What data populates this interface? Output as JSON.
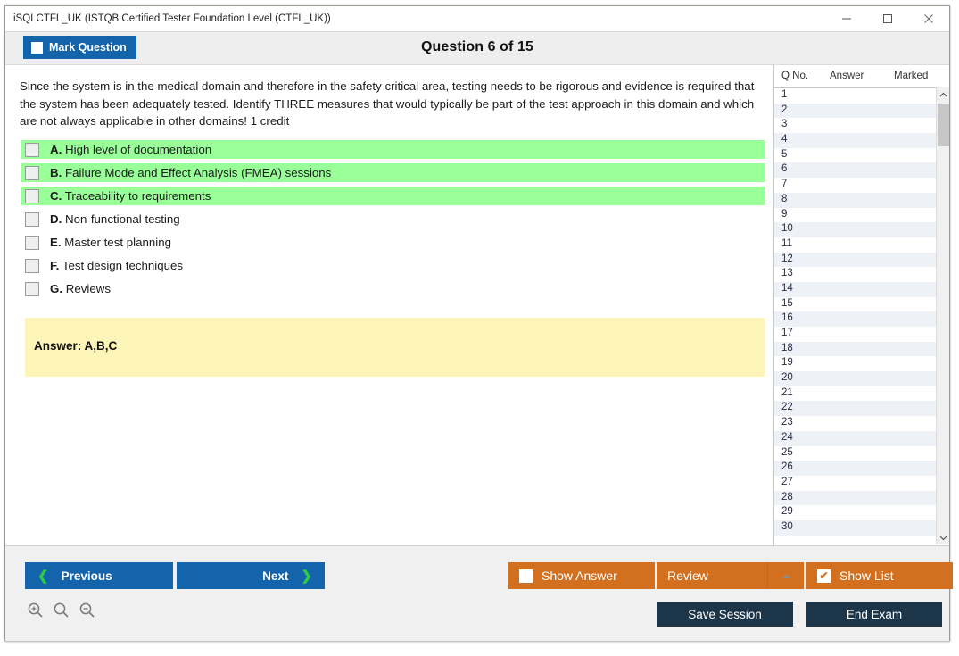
{
  "window": {
    "title": "iSQI CTFL_UK (ISTQB Certified Tester Foundation Level (CTFL_UK))",
    "minimize_label": "Minimize",
    "maximize_label": "Maximize",
    "close_label": "Close"
  },
  "header": {
    "mark_question_label": "Mark Question",
    "question_counter": "Question 6 of 15"
  },
  "question": {
    "text": "Since the system is in the medical domain and therefore in the safety critical area, testing needs to be rigorous and evidence is required that the system has been adequately tested. Identify THREE measures that would typically be part of the test approach in this domain and which are not always applicable in other domains! 1 credit",
    "options": [
      {
        "letter": "A.",
        "text": "High level of documentation",
        "correct": true
      },
      {
        "letter": "B.",
        "text": "Failure Mode and Effect Analysis (FMEA) sessions",
        "correct": true
      },
      {
        "letter": "C.",
        "text": "Traceability to requirements",
        "correct": true
      },
      {
        "letter": "D.",
        "text": "Non-functional testing",
        "correct": false
      },
      {
        "letter": "E.",
        "text": "Master test planning",
        "correct": false
      },
      {
        "letter": "F.",
        "text": "Test design techniques",
        "correct": false
      },
      {
        "letter": "G.",
        "text": "Reviews",
        "correct": false
      }
    ],
    "answer_label": "Answer: A,B,C"
  },
  "question_list": {
    "columns": [
      "Q No.",
      "Answer",
      "Marked"
    ],
    "rows": [
      {
        "no": "1",
        "answer": "",
        "marked": ""
      },
      {
        "no": "2",
        "answer": "",
        "marked": ""
      },
      {
        "no": "3",
        "answer": "",
        "marked": ""
      },
      {
        "no": "4",
        "answer": "",
        "marked": ""
      },
      {
        "no": "5",
        "answer": "",
        "marked": ""
      },
      {
        "no": "6",
        "answer": "",
        "marked": ""
      },
      {
        "no": "7",
        "answer": "",
        "marked": ""
      },
      {
        "no": "8",
        "answer": "",
        "marked": ""
      },
      {
        "no": "9",
        "answer": "",
        "marked": ""
      },
      {
        "no": "10",
        "answer": "",
        "marked": ""
      },
      {
        "no": "11",
        "answer": "",
        "marked": ""
      },
      {
        "no": "12",
        "answer": "",
        "marked": ""
      },
      {
        "no": "13",
        "answer": "",
        "marked": ""
      },
      {
        "no": "14",
        "answer": "",
        "marked": ""
      },
      {
        "no": "15",
        "answer": "",
        "marked": ""
      },
      {
        "no": "16",
        "answer": "",
        "marked": ""
      },
      {
        "no": "17",
        "answer": "",
        "marked": ""
      },
      {
        "no": "18",
        "answer": "",
        "marked": ""
      },
      {
        "no": "19",
        "answer": "",
        "marked": ""
      },
      {
        "no": "20",
        "answer": "",
        "marked": ""
      },
      {
        "no": "21",
        "answer": "",
        "marked": ""
      },
      {
        "no": "22",
        "answer": "",
        "marked": ""
      },
      {
        "no": "23",
        "answer": "",
        "marked": ""
      },
      {
        "no": "24",
        "answer": "",
        "marked": ""
      },
      {
        "no": "25",
        "answer": "",
        "marked": ""
      },
      {
        "no": "26",
        "answer": "",
        "marked": ""
      },
      {
        "no": "27",
        "answer": "",
        "marked": ""
      },
      {
        "no": "28",
        "answer": "",
        "marked": ""
      },
      {
        "no": "29",
        "answer": "",
        "marked": ""
      },
      {
        "no": "30",
        "answer": "",
        "marked": ""
      }
    ]
  },
  "footer": {
    "previous_label": "Previous",
    "next_label": "Next",
    "show_answer_label": "Show Answer",
    "show_answer_checked": false,
    "review_label": "Review",
    "show_list_label": "Show List",
    "show_list_checked": true,
    "save_session_label": "Save Session",
    "end_exam_label": "End Exam",
    "check_mark": "✔"
  },
  "colors": {
    "primary_blue": "#1464ab",
    "orange": "#d2701f",
    "navy": "#1d3548",
    "correct_green": "#99ff99",
    "answer_yellow": "#fdf5b8",
    "chevron_green": "#2ecc40"
  }
}
